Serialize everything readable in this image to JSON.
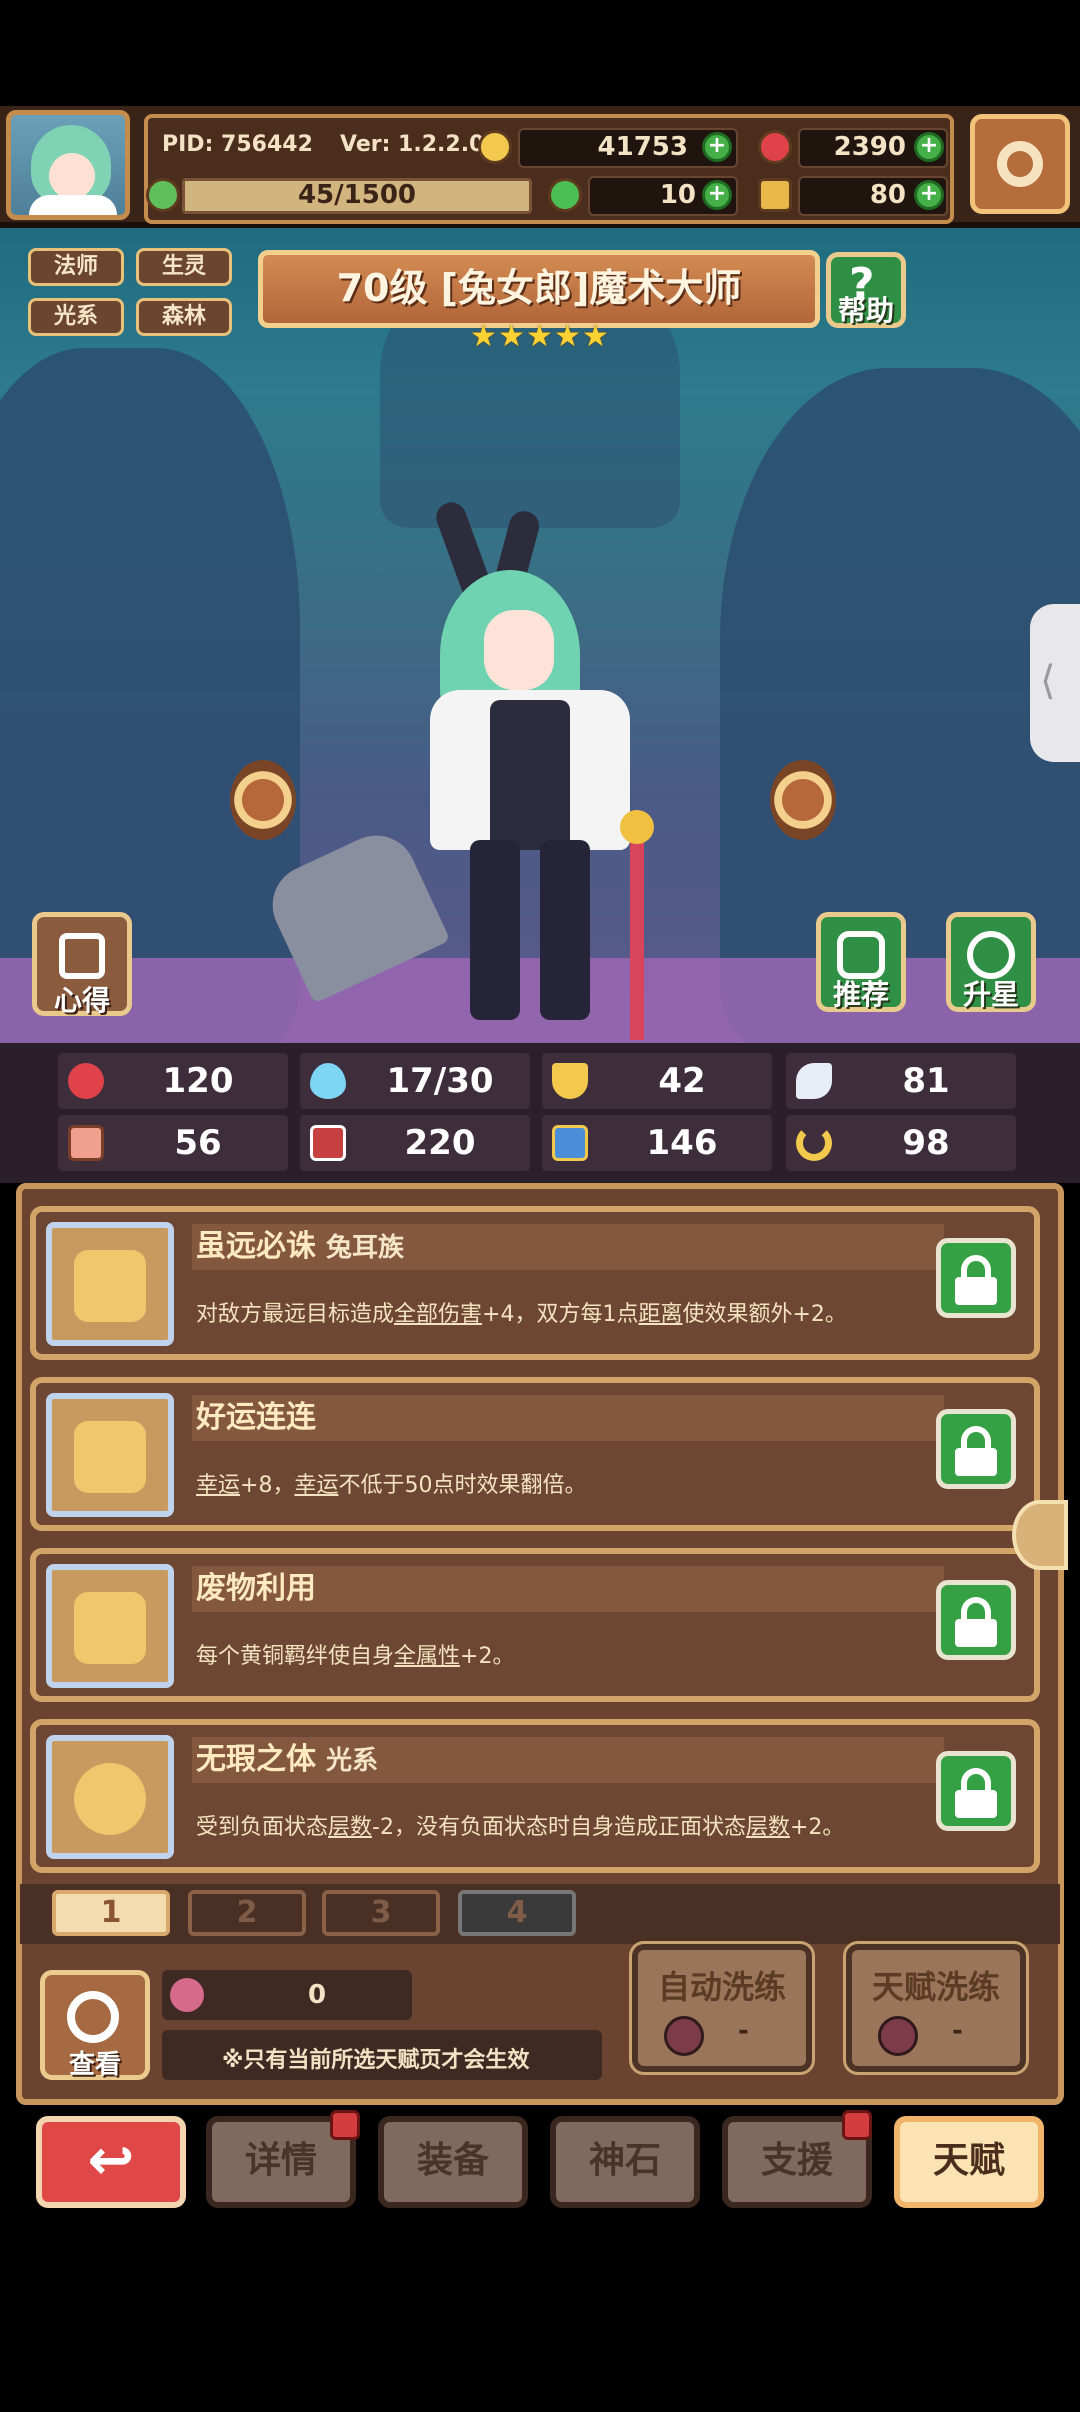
{
  "header": {
    "pid": "PID: 756442",
    "version": "Ver: 1.2.2.0",
    "gold": "41753",
    "gems": "2390",
    "energy": "45/1500",
    "clover": "10",
    "shards": "80"
  },
  "hero": {
    "tags": [
      "法师",
      "生灵",
      "光系",
      "森林"
    ],
    "title": "70级 [兔女郎]魔术大师",
    "stars": 5,
    "help_label": "帮助",
    "notes_label": "心得",
    "recommend_label": "推荐",
    "upgrade_label": "升星"
  },
  "stats": [
    {
      "icon": "heart-icon",
      "value": "120"
    },
    {
      "icon": "mana-drop-icon",
      "value": "17/30"
    },
    {
      "icon": "shield-icon",
      "value": "42"
    },
    {
      "icon": "wing-icon",
      "value": "81"
    },
    {
      "icon": "fist-icon",
      "value": "56"
    },
    {
      "icon": "book-icon",
      "value": "220"
    },
    {
      "icon": "boot-icon",
      "value": "146"
    },
    {
      "icon": "horseshoe-icon",
      "value": "98"
    }
  ],
  "talents": [
    {
      "name": "虽远必诛",
      "sub": "兔耳族",
      "desc_parts": [
        "对敌方最远目标造成",
        "全部伤害",
        "+4，双方每1点",
        "距离",
        "使效果额外+2。"
      ]
    },
    {
      "name": "好运连连",
      "sub": "",
      "desc_parts": [
        "",
        "幸运",
        "+8，",
        "幸运",
        "不低于50点时效果翻倍。"
      ]
    },
    {
      "name": "废物利用",
      "sub": "",
      "desc_parts": [
        "每个黄铜羁绊使自身",
        "全属性",
        "+2。",
        "",
        ""
      ]
    },
    {
      "name": "无瑕之体",
      "sub": "光系",
      "desc_parts": [
        "受到负面状态",
        "层数",
        "-2，没有负面状态时自身造成正面状态",
        "层数",
        "+2。"
      ]
    }
  ],
  "pages": [
    "1",
    "2",
    "3",
    "4"
  ],
  "footer": {
    "view_label": "查看",
    "potion_count": "0",
    "notice": "※只有当前所选天赋页才会生效",
    "auto_refine_label": "自动洗练",
    "auto_refine_value": "-",
    "talent_refine_label": "天赋洗练",
    "talent_refine_value": "-"
  },
  "nav": {
    "details": "详情",
    "equipment": "装备",
    "godstone": "神石",
    "support": "支援",
    "talent": "天赋"
  },
  "colors": {
    "accent_gold": "#c58d4d",
    "green_button": "#35a144",
    "red_back": "#e04848",
    "active_tab": "#fbe3b3"
  }
}
